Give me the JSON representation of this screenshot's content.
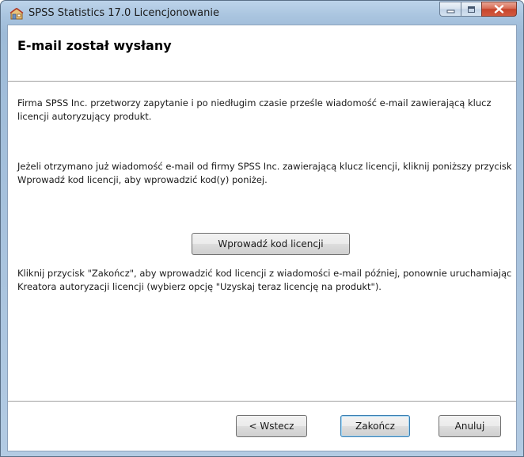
{
  "window": {
    "title": "SPSS Statistics 17.0 Licencjonowanie",
    "icon": "license-wizard-icon",
    "controls": [
      "minimize-icon",
      "maximize-icon",
      "close-icon"
    ]
  },
  "header": {
    "title": "E-mail został wysłany"
  },
  "main": {
    "paragraph1": "Firma SPSS Inc. przetworzy zapytanie i po niedługim czasie prześle wiadomość e-mail zawierającą klucz licencji autoryzujący produkt.",
    "paragraph2": "Jeżeli otrzymano już wiadomość e-mail od firmy SPSS Inc. zawierającą klucz licencji, kliknij poniższy przycisk Wprowadź kod licencji, aby wprowadzić kod(y) poniżej.",
    "enter_code_button": "Wprowadź kod licencji",
    "paragraph3": "Kliknij przycisk \"Zakończ\", aby wprowadzić kod licencji z wiadomości e-mail później, ponownie uruchamiając Kreatora autoryzacji licencji (wybierz opcję \"Uzyskaj teraz licencję na produkt\")."
  },
  "footer": {
    "back_label": "< Wstecz",
    "finish_label": "Zakończ",
    "cancel_label": "Anuluj"
  },
  "colors": {
    "titlebar": "#a9c4df",
    "close_button": "#c7452c",
    "default_button_border": "#3c7fb1"
  }
}
